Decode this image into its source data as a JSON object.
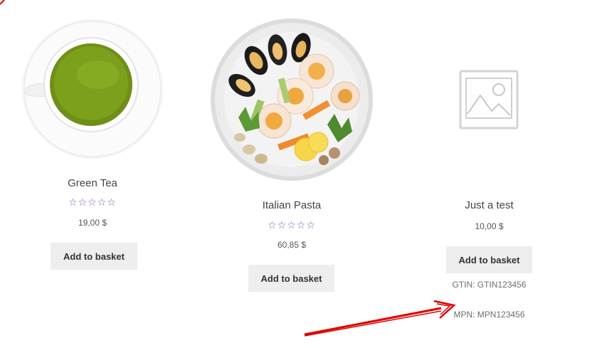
{
  "products": [
    {
      "title": "Green Tea",
      "rating_stars": "☆☆☆☆☆",
      "rating_value": 0,
      "price": "19,00 $",
      "button_label": "Add to basket"
    },
    {
      "title": "Italian Pasta",
      "rating_stars": "☆☆☆☆☆",
      "rating_value": 0.2,
      "price": "60,85 $",
      "button_label": "Add to basket"
    },
    {
      "title": "Just a test",
      "price": "10,00 $",
      "button_label": "Add to basket",
      "gtin": "GTIN: GTIN123456",
      "mpn": "MPN: MPN123456"
    }
  ],
  "colors": {
    "star": "#7f54b3",
    "button_bg": "#eeeeee",
    "annotation_arrow": "#e00000"
  },
  "icons": {
    "placeholder": "image-placeholder-icon",
    "annotation": "red-arrow-annotation"
  }
}
